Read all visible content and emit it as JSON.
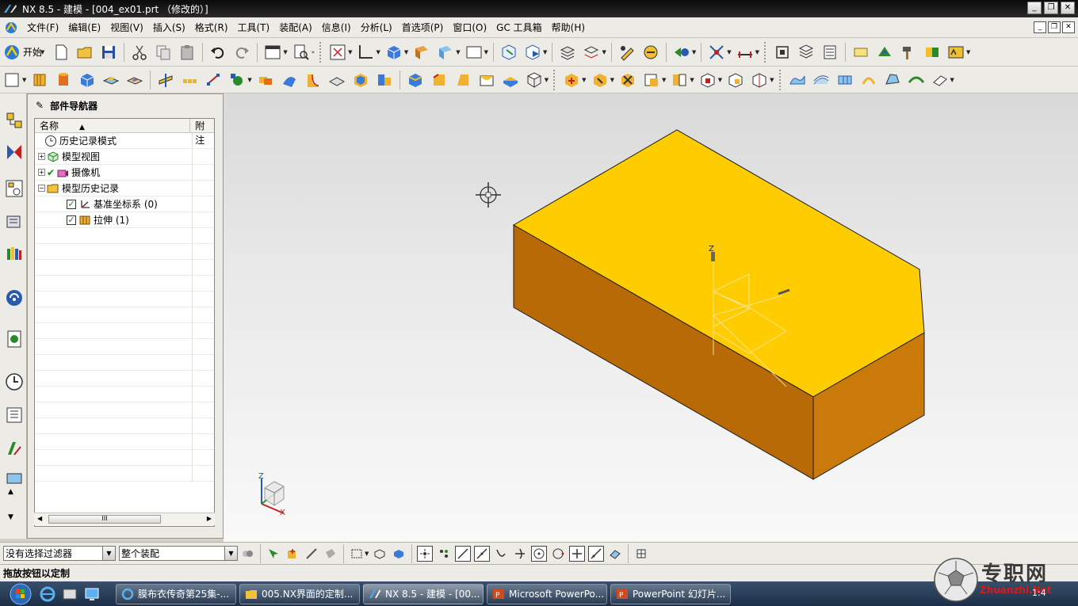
{
  "titlebar": {
    "title": "NX 8.5 - 建模 - [004_ex01.prt （修改的）]",
    "minimize": "_",
    "restore": "❐",
    "close": "✕"
  },
  "menubar": {
    "items": [
      "文件(F)",
      "编辑(E)",
      "视图(V)",
      "插入(S)",
      "格式(R)",
      "工具(T)",
      "装配(A)",
      "信息(I)",
      "分析(L)",
      "首选项(P)",
      "窗口(O)",
      "GC 工具箱",
      "帮助(H)"
    ]
  },
  "toolbar": {
    "start_label": "开始"
  },
  "navigator": {
    "title": "部件导航器",
    "columns": {
      "name": "名称",
      "note": "附注"
    },
    "rows": [
      {
        "label": "历史记录模式",
        "icon": "clock-icon"
      },
      {
        "label": "模型视图",
        "icon": "model-view-icon"
      },
      {
        "label": "摄像机",
        "icon": "camera-icon"
      },
      {
        "label": "模型历史记录",
        "icon": "folder-icon"
      },
      {
        "label": "基准坐标系 (0)",
        "icon": "datum-csys-icon"
      },
      {
        "label": "拉伸 (1)",
        "icon": "extrude-icon"
      }
    ],
    "scroll_thumb": "III"
  },
  "graphics": {
    "axis_z": "Z",
    "triad_z": "Z",
    "triad_x": "X",
    "colors": {
      "top_face": "#ffcc00",
      "front_face": "#b86a06",
      "right_face": "#c97a0a",
      "edge": "#1a1a1a"
    }
  },
  "selbar": {
    "filter_value": "没有选择过滤器",
    "scope_value": "整个装配"
  },
  "statusbar": {
    "message": "拖放按钮以定制"
  },
  "taskbar": {
    "tasks": [
      {
        "label": "膜布衣传奇第25集-...",
        "icon": "ie-icon"
      },
      {
        "label": "005.NX界面的定制...",
        "icon": "folder-icon"
      },
      {
        "label": "NX 8.5 - 建模 - [00...",
        "icon": "nx-icon"
      },
      {
        "label": "Microsoft PowerPo...",
        "icon": "powerpoint-icon"
      },
      {
        "label": "PowerPoint 幻灯片...",
        "icon": "powerpoint-icon"
      }
    ],
    "clock": "1:4"
  },
  "watermark": {
    "text": "专职网",
    "url": "Zhuanzhi.Net"
  }
}
